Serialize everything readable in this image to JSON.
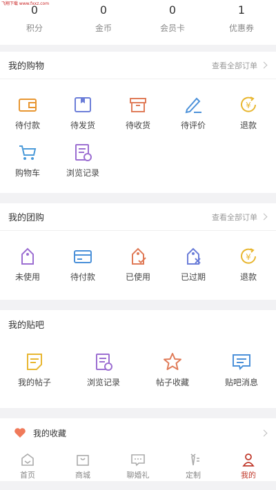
{
  "watermark": "飞翔下载 www.fxxz.com",
  "stats": [
    {
      "value": "0",
      "label": "积分"
    },
    {
      "value": "0",
      "label": "金币"
    },
    {
      "value": "0",
      "label": "会员卡"
    },
    {
      "value": "1",
      "label": "优惠券"
    }
  ],
  "shopping": {
    "title": "我的购物",
    "link": "查看全部订单",
    "items": [
      {
        "label": "待付款",
        "icon": "wallet-icon"
      },
      {
        "label": "待发货",
        "icon": "package-icon"
      },
      {
        "label": "待收货",
        "icon": "box-icon"
      },
      {
        "label": "待评价",
        "icon": "pencil-icon"
      },
      {
        "label": "退款",
        "icon": "yen-refund-icon"
      },
      {
        "label": "购物车",
        "icon": "cart-icon"
      },
      {
        "label": "浏览记录",
        "icon": "history-icon"
      }
    ]
  },
  "group": {
    "title": "我的团购",
    "link": "查看全部订单",
    "items": [
      {
        "label": "未使用",
        "icon": "tag-icon"
      },
      {
        "label": "待付款",
        "icon": "card-icon"
      },
      {
        "label": "已使用",
        "icon": "tag-check-icon"
      },
      {
        "label": "已过期",
        "icon": "tag-expired-icon"
      },
      {
        "label": "退款",
        "icon": "yen-refund-icon"
      }
    ]
  },
  "tieba": {
    "title": "我的贴吧",
    "items": [
      {
        "label": "我的帖子",
        "icon": "note-icon"
      },
      {
        "label": "浏览记录",
        "icon": "history-icon"
      },
      {
        "label": "帖子收藏",
        "icon": "star-icon"
      },
      {
        "label": "贴吧消息",
        "icon": "message-icon"
      }
    ]
  },
  "favorites": {
    "label": "我的收藏",
    "icon": "heart-icon"
  },
  "tabbar": [
    {
      "label": "首页",
      "icon": "home-icon",
      "active": false
    },
    {
      "label": "商城",
      "icon": "shop-icon",
      "active": false
    },
    {
      "label": "聊婚礼",
      "icon": "chat-icon",
      "active": false
    },
    {
      "label": "定制",
      "icon": "suit-icon",
      "active": false
    },
    {
      "label": "我的",
      "icon": "user-icon",
      "active": true
    }
  ],
  "colors": {
    "accent": "#c0392b",
    "orange": "#e8952f",
    "purple": "#9b6dd1",
    "blue": "#4a90d9"
  }
}
